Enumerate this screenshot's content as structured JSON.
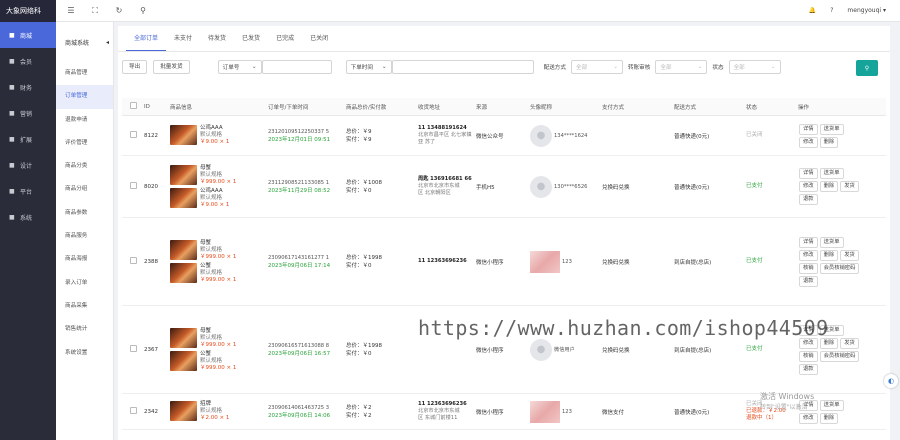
{
  "brand": "大象网络科",
  "nav": [
    {
      "icon": "store-icon",
      "label": "商城",
      "active": true
    },
    {
      "icon": "user-icon",
      "label": "会员"
    },
    {
      "icon": "finance-icon",
      "label": "财务"
    },
    {
      "icon": "marketing-icon",
      "label": "营销"
    },
    {
      "icon": "extend-icon",
      "label": "扩展"
    },
    {
      "icon": "design-icon",
      "label": "设计"
    },
    {
      "icon": "platform-icon",
      "label": "平台"
    },
    {
      "icon": "system-icon",
      "label": "系统"
    }
  ],
  "sub": {
    "title": "商城系统",
    "items": [
      "商品管理",
      "订单管理",
      "退款申请",
      "评价管理",
      "商品分类",
      "商品分组",
      "商品参数",
      "商品服务",
      "商品海报",
      "录入订单",
      "商品采集",
      "销售统计",
      "系统设置"
    ]
  },
  "top": {
    "user": "mengyouqi"
  },
  "tabs": [
    "全部订单",
    "未支付",
    "待发货",
    "已发货",
    "已完成",
    "已关闭"
  ],
  "filters": {
    "export": "导出",
    "batch": "批量发货",
    "order_no": "订单号",
    "time": "下单时间",
    "pay_method": "配送方式",
    "pay_ph": "全部",
    "transfer": "转账审核",
    "transfer_ph": "全部",
    "status": "状态",
    "status_ph": "全部"
  },
  "headers": [
    "ID",
    "商品信息",
    "订单号/下单时间",
    "商品总价/实付款",
    "收货地址",
    "来源",
    "头像昵称",
    "支付方式",
    "配送方式",
    "状态",
    "操作"
  ],
  "rows": [
    {
      "id": "8122",
      "products": [
        {
          "name": "公鸡AAA",
          "spec": "默认规格",
          "price": "￥9.00 × 1"
        }
      ],
      "order_no": "23120109512250337 5",
      "time": "2023年12月01日 09:51",
      "total": "总价：￥9",
      "paid": "实付：￥9",
      "addr1": "11 13488191624",
      "addr2": "北京市昌平区 北七家镇",
      "addr3": "亚 苏了",
      "source": "微信公众号",
      "nick": "134****1624",
      "avatar": "round",
      "pay": "",
      "ship": "普通快递(0元)",
      "status": "已关闭",
      "status_cls": "gray",
      "ops": [
        "详情",
        "送货单",
        "修改",
        "删除"
      ]
    },
    {
      "id": "8020",
      "products": [
        {
          "name": "母蟹",
          "spec": "默认规格",
          "price": "￥999.00 × 1"
        },
        {
          "name": "公鸡AAA",
          "spec": "默认规格",
          "price": "￥9.00 × 1"
        }
      ],
      "order_no": "23112908521133085 1",
      "time": "2023年11月29日 08:52",
      "total": "总价：￥1008",
      "paid": "实付：￥0",
      "addr1": "周匙 136916681 66",
      "addr2": "北京市北京市东城",
      "addr3": "区 北京朝阳区",
      "source": "手机H5",
      "nick": "130****6526",
      "avatar": "round",
      "pay": "兑换码兑换",
      "ship": "普通快递(0元)",
      "status": "已支付",
      "status_cls": "green",
      "ops": [
        "详情",
        "送货单",
        "修改",
        "删除",
        "发货",
        "退款"
      ]
    },
    {
      "id": "2388",
      "products": [
        {
          "name": "母蟹",
          "spec": "默认规格",
          "price": "￥999.00 × 1"
        },
        {
          "name": "公蟹",
          "spec": "默认规格",
          "price": "￥999.00 × 1"
        }
      ],
      "order_no": "23090617143161277 1",
      "time": "2023年09月06日 17:14",
      "total": "总价：￥1998",
      "paid": "实付：￥0",
      "addr1": "11 12363696236",
      "addr2": "",
      "addr3": "",
      "source": "微信小程序",
      "nick": "123",
      "avatar": "square",
      "pay": "兑换码兑换",
      "ship": "到店自提(总店)",
      "status": "已支付",
      "status_cls": "green",
      "ops": [
        "详情",
        "送货单",
        "修改",
        "删除",
        "发货",
        "核销",
        "会员核销密码",
        "退款"
      ]
    },
    {
      "id": "2367",
      "products": [
        {
          "name": "母蟹",
          "spec": "默认规格",
          "price": "￥999.00 × 1"
        },
        {
          "name": "公蟹",
          "spec": "默认规格",
          "price": "￥999.00 × 1"
        }
      ],
      "order_no": "23090616571613088 8",
      "time": "2023年09月06日 16:57",
      "total": "总价：￥1998",
      "paid": "实付：￥0",
      "addr1": "",
      "addr2": "",
      "addr3": "",
      "source": "微信小程序",
      "nick": "微信用户",
      "avatar": "round",
      "pay": "兑换码兑换",
      "ship": "到店自提(总店)",
      "status": "已支付",
      "status_cls": "green",
      "ops": [
        "详情",
        "送货单",
        "修改",
        "删除",
        "发货",
        "核销",
        "会员核销密码",
        "退款"
      ]
    },
    {
      "id": "2342",
      "products": [
        {
          "name": "招牌",
          "spec": "默认规格",
          "price": "￥2.00 × 1"
        }
      ],
      "order_no": "23090614061463725 3",
      "time": "2023年09月06日 14:06",
      "total": "总价：￥2",
      "paid": "实付：￥2",
      "addr1": "11 12363696236",
      "addr2": "北京市北京市东城",
      "addr3": "区 东城门前楼11",
      "source": "微信小程序",
      "nick": "123",
      "avatar": "square",
      "pay": "微信支付",
      "ship": "普通快递(0元)",
      "status": "已关闭",
      "status_cls": "gray",
      "extra1": "已退款：￥2.00",
      "extra2": "退款中（1）",
      "ops": [
        "详情",
        "送货单",
        "修改",
        "删除"
      ]
    }
  ],
  "watermark": "https://www.huzhan.com/ishop44509",
  "windows": {
    "line1": "激活 Windows",
    "line2": "转到\"设置\"以激活"
  }
}
